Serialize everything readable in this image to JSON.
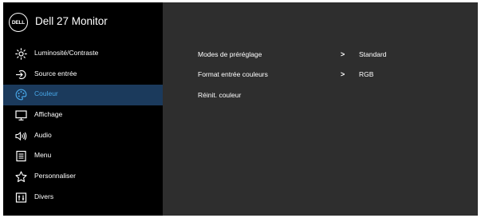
{
  "app": {
    "logo": "DELL",
    "title": "Dell 27 Monitor"
  },
  "sidebar": {
    "items": [
      {
        "label": "Luminosité/Contraste",
        "icon": "brightness-icon"
      },
      {
        "label": "Source entrée",
        "icon": "input-source-icon"
      },
      {
        "label": "Couleur",
        "icon": "palette-icon",
        "selected": true
      },
      {
        "label": "Affichage",
        "icon": "monitor-icon"
      },
      {
        "label": "Audio",
        "icon": "speaker-icon"
      },
      {
        "label": "Menu",
        "icon": "menu-icon"
      },
      {
        "label": "Personnaliser",
        "icon": "star-icon"
      },
      {
        "label": "Divers",
        "icon": "settings-icon"
      }
    ]
  },
  "content": {
    "rows": [
      {
        "label": "Modes de préréglage",
        "chevron": ">",
        "value": "Standard"
      },
      {
        "label": "Format entrée couleurs",
        "chevron": ">",
        "value": "RGB"
      },
      {
        "label": "Réinit. couleur"
      }
    ]
  },
  "colors": {
    "sidebar_bg": "#000000",
    "content_bg": "#2e2e2e",
    "selected_bg": "#1b3a5c",
    "selected_text": "#48a7e8"
  }
}
